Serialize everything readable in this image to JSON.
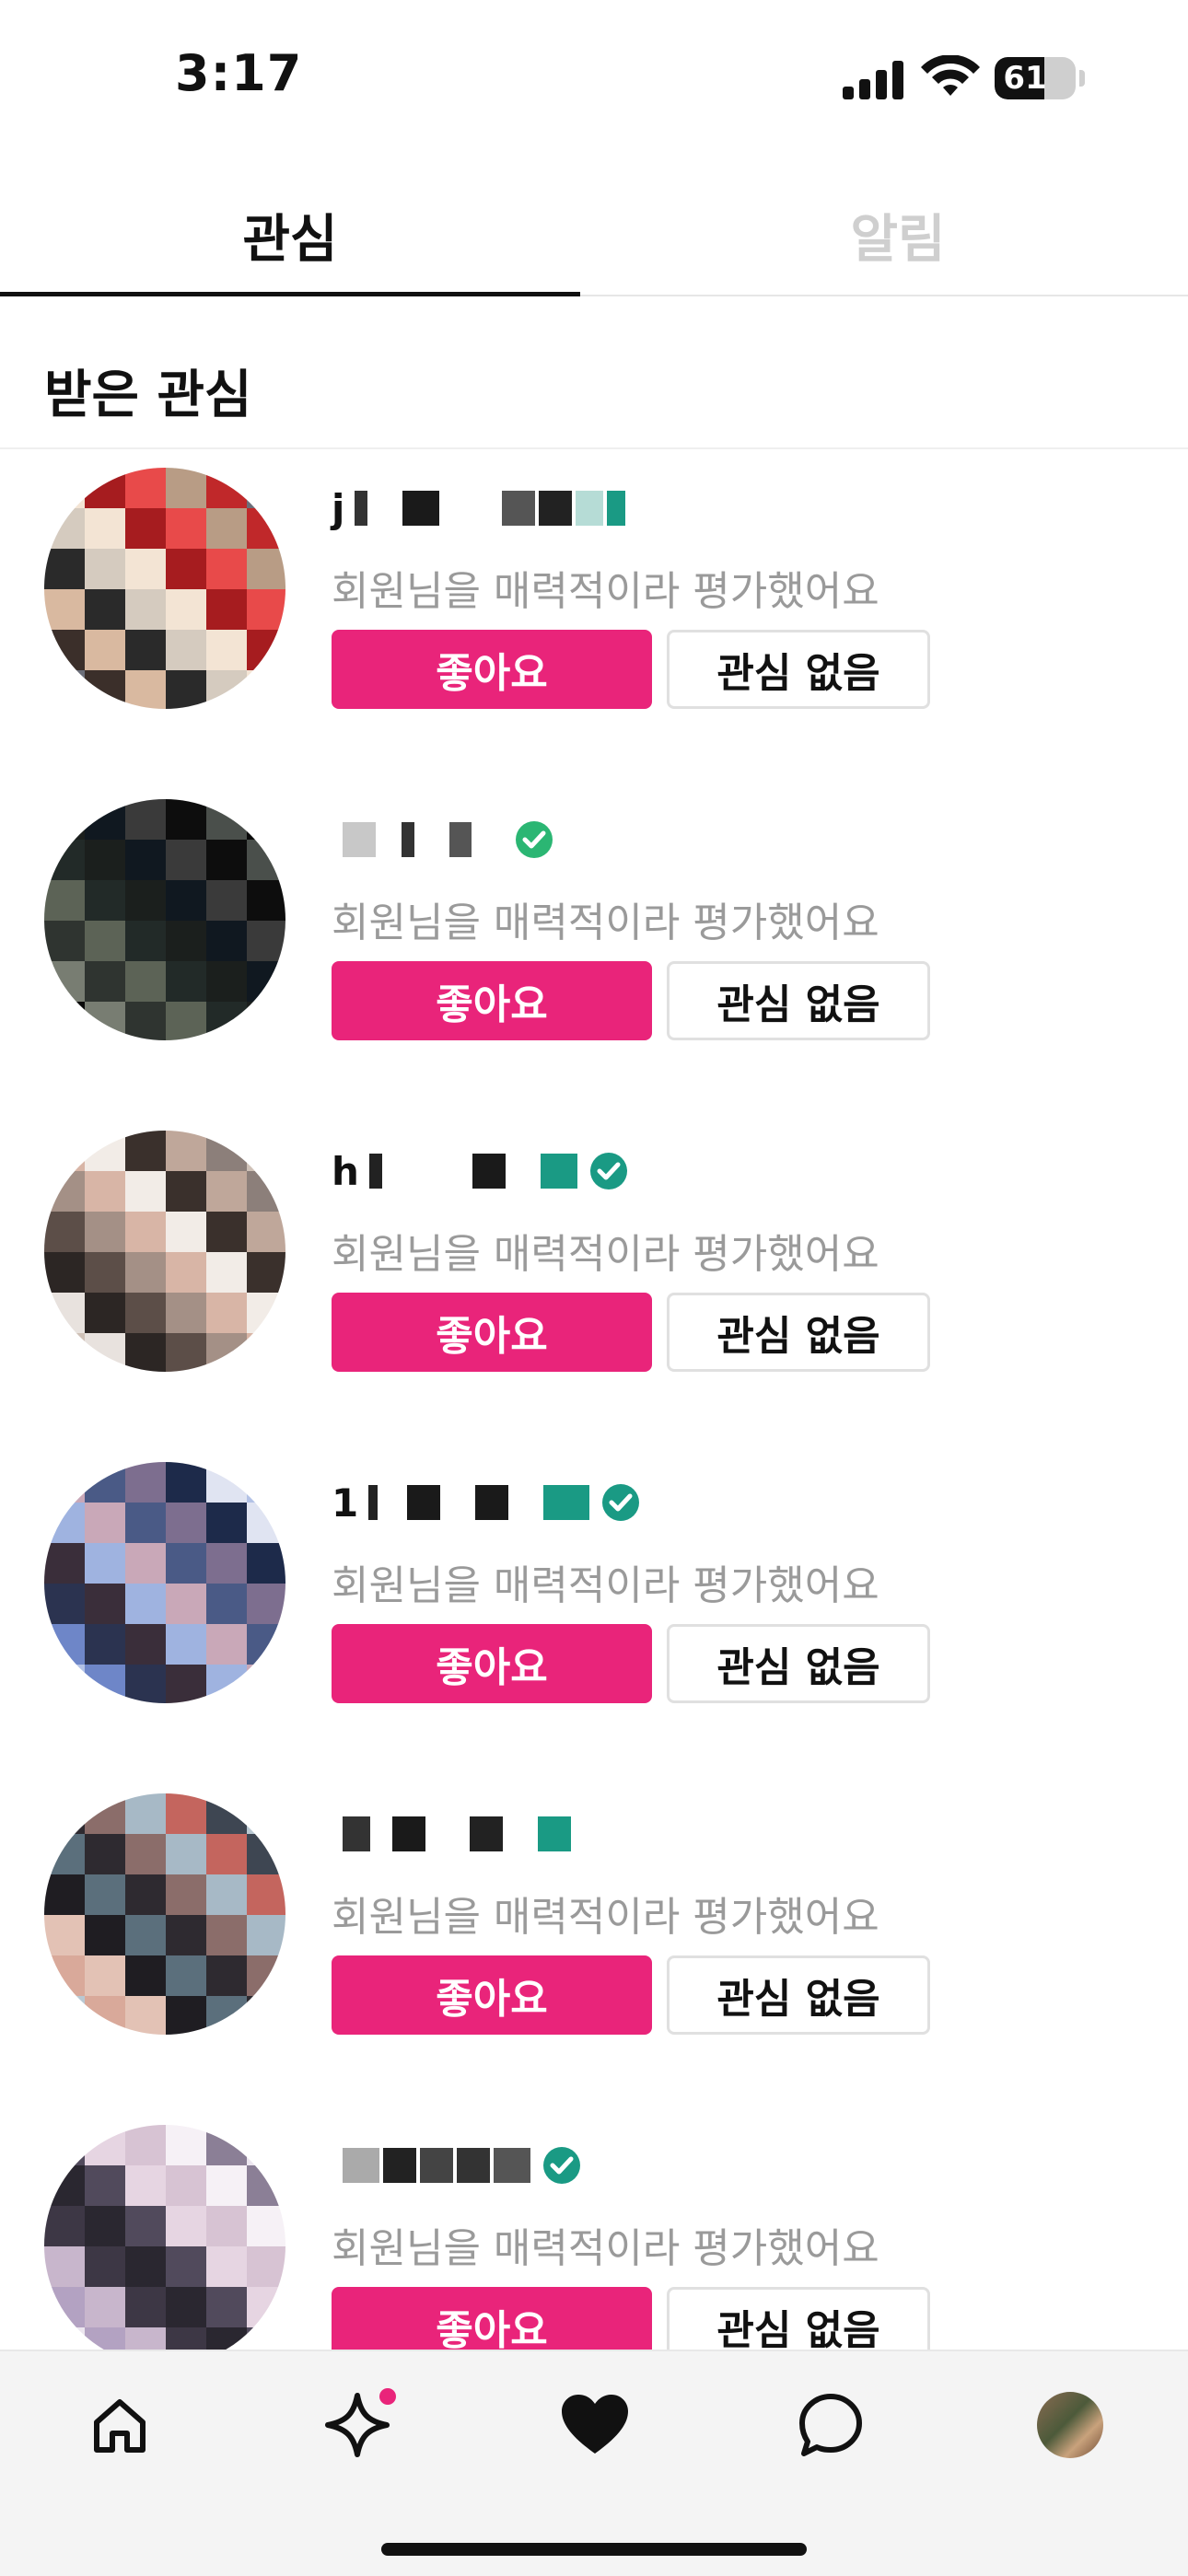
{
  "status_bar": {
    "time": "3:17",
    "battery": "61",
    "battery_level": 0.61
  },
  "tabs": [
    {
      "label": "관심",
      "active": true
    },
    {
      "label": "알림",
      "active": false
    }
  ],
  "section": {
    "title": "받은 관심"
  },
  "items": [
    {
      "name": "j",
      "description": "회원님을 매력적이라 평가했어요",
      "like_label": "좋아요",
      "pass_label": "관심 없음",
      "verified": false
    },
    {
      "name": "",
      "description": "회원님을 매력적이라 평가했어요",
      "like_label": "좋아요",
      "pass_label": "관심 없음",
      "verified": true
    },
    {
      "name": "h",
      "description": "회원님을 매력적이라 평가했어요",
      "like_label": "좋아요",
      "pass_label": "관심 없음",
      "verified": true
    },
    {
      "name": "1",
      "description": "회원님을 매력적이라 평가했어요",
      "like_label": "좋아요",
      "pass_label": "관심 없음",
      "verified": true
    },
    {
      "name": "",
      "description": "회원님을 매력적이라 평가했어요",
      "like_label": "좋아요",
      "pass_label": "관심 없음",
      "verified": false
    },
    {
      "name": "",
      "description": "회원님을 매력적이라 평가했어요",
      "like_label": "좋아요",
      "pass_label": "관심 없음",
      "verified": true
    }
  ],
  "nav": {
    "items": [
      {
        "icon": "home-icon"
      },
      {
        "icon": "sparkle-icon",
        "badge": true
      },
      {
        "icon": "heart-icon",
        "active": true
      },
      {
        "icon": "chat-bubble-icon"
      },
      {
        "icon": "profile-avatar"
      }
    ]
  },
  "colors": {
    "accent": "#e9247a",
    "verified": "#2bb673",
    "muted_text": "#9a9a9a",
    "inactive_tab": "#cfcfcf"
  }
}
